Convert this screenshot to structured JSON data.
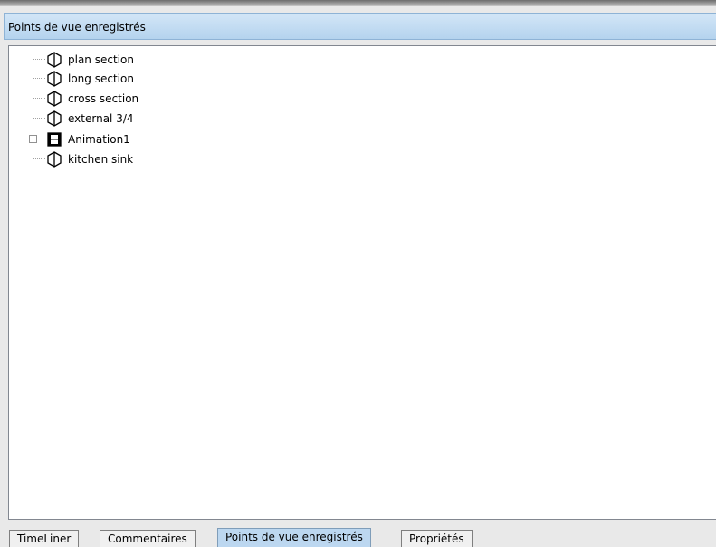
{
  "panel": {
    "title": "Points de vue enregistrés"
  },
  "tree": {
    "items": [
      {
        "label": "plan section",
        "icon": "viewpoint-icon"
      },
      {
        "label": "long section",
        "icon": "viewpoint-icon"
      },
      {
        "label": "cross section",
        "icon": "viewpoint-icon"
      },
      {
        "label": "external 3/4",
        "icon": "viewpoint-icon"
      },
      {
        "label": "Animation1",
        "icon": "animation-film-icon",
        "expandable": true
      },
      {
        "label": "kitchen sink",
        "icon": "viewpoint-icon"
      }
    ]
  },
  "tabs": [
    {
      "label": "TimeLiner",
      "active": false
    },
    {
      "label": "Commentaires",
      "active": false
    },
    {
      "label": "Points de vue enregistrés",
      "active": true
    },
    {
      "label": "Propriétés",
      "active": false
    }
  ],
  "colors": {
    "header_bg": "#c5ddf3",
    "active_tab_bg": "#bcd7f0",
    "tree_bg": "#ffffff"
  }
}
